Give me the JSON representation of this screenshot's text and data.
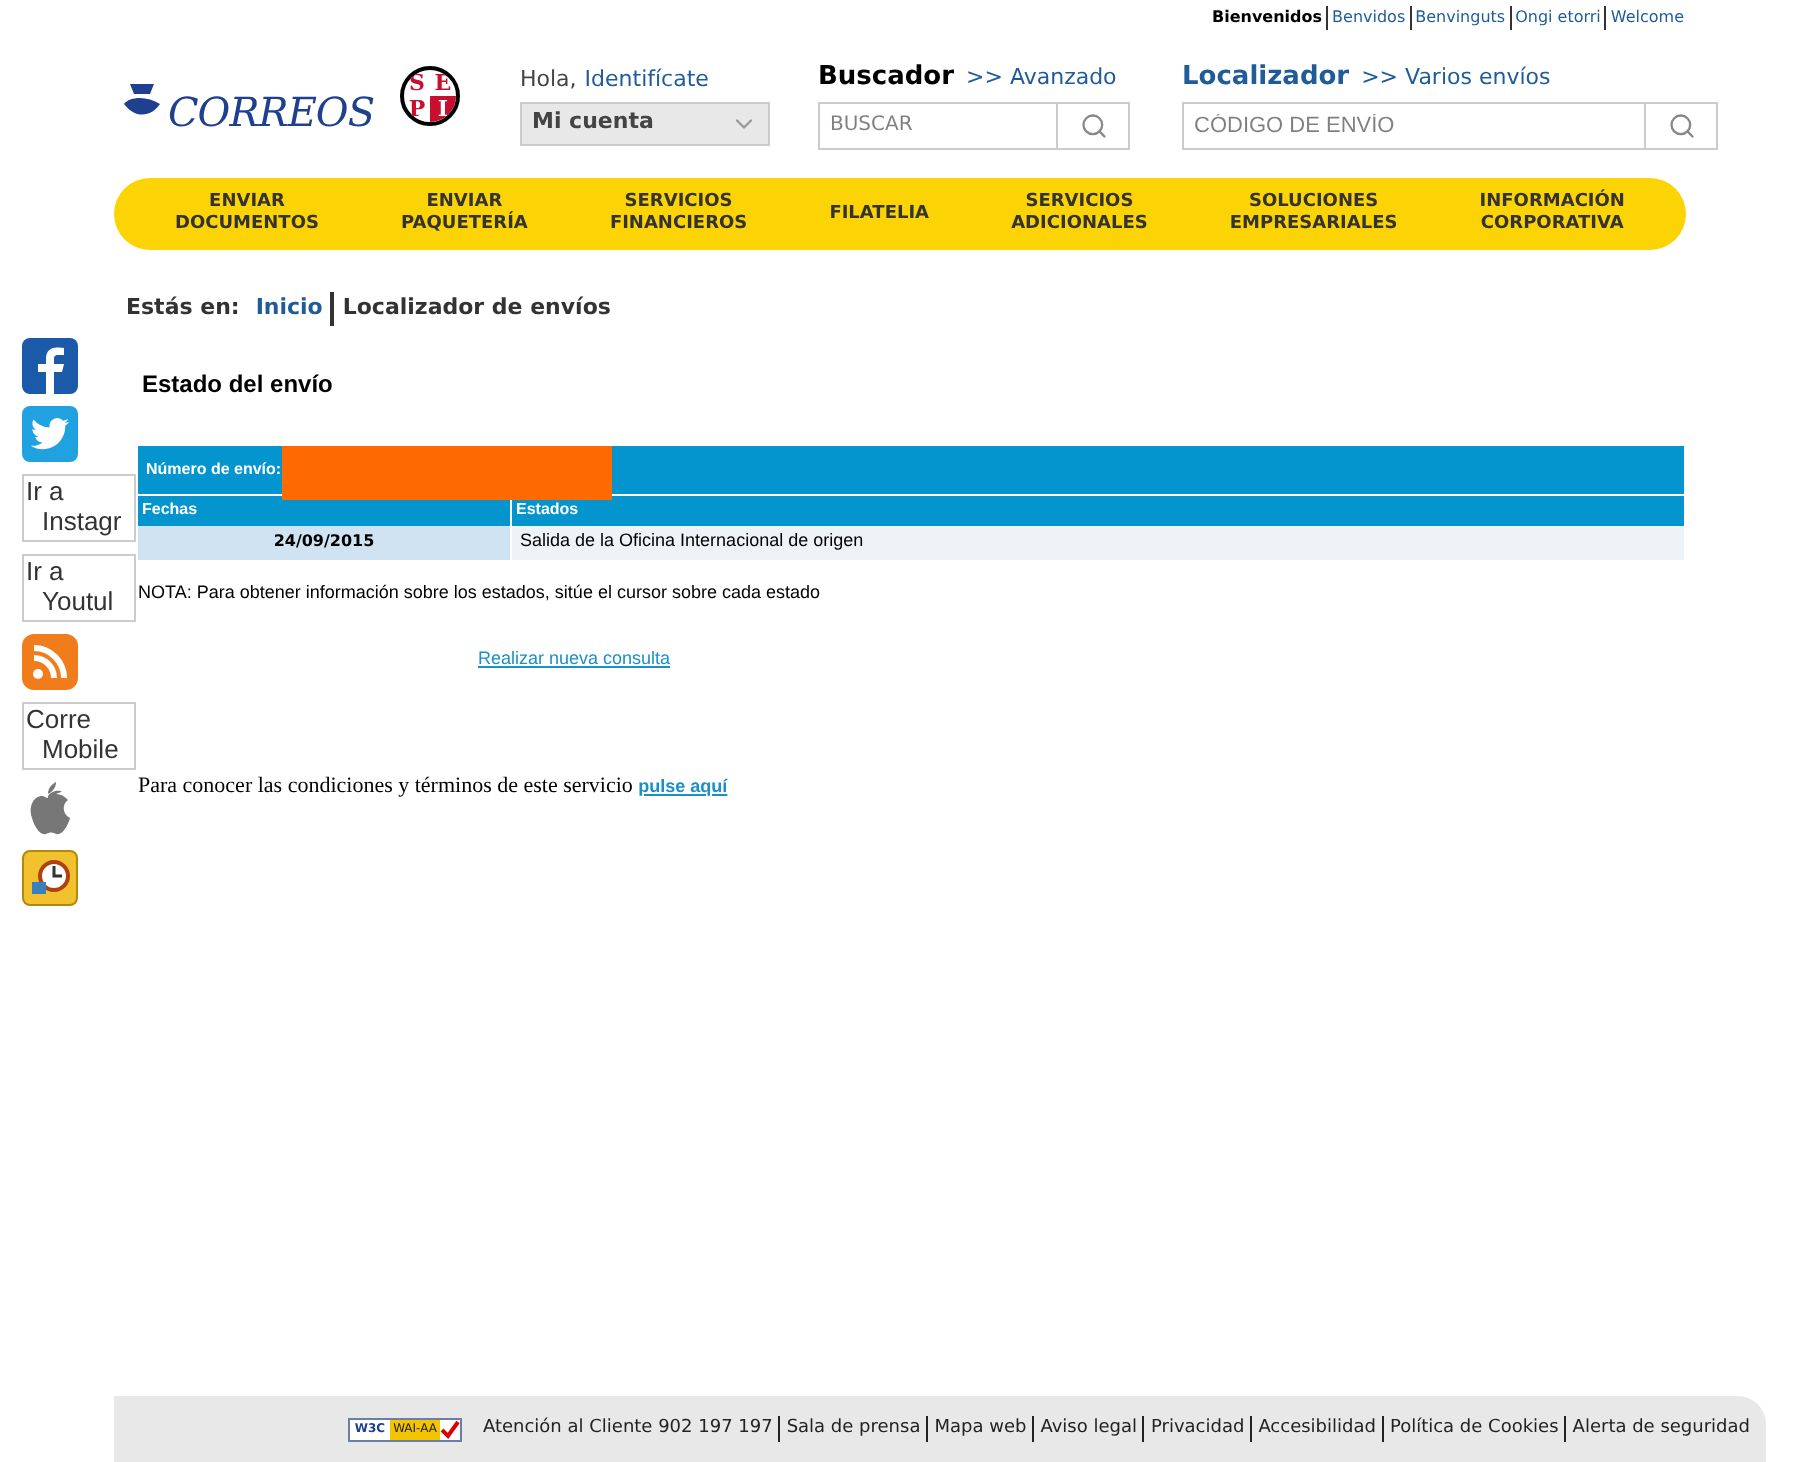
{
  "languages": [
    {
      "label": "Bienvenidos",
      "selected": true
    },
    {
      "label": "Benvidos",
      "selected": false
    },
    {
      "label": "Benvinguts",
      "selected": false
    },
    {
      "label": "Ongi etorri",
      "selected": false
    },
    {
      "label": "Welcome",
      "selected": false
    }
  ],
  "logo": {
    "brand": "CORREOS",
    "badge": [
      "S",
      "E",
      "P",
      "I"
    ]
  },
  "account": {
    "greeting": "Hola,",
    "login_link": "Identifícate",
    "dropdown": "Mi cuenta"
  },
  "search": {
    "title": "Buscador",
    "link": ">> Avanzado",
    "placeholder": "BUSCAR"
  },
  "locator": {
    "title": "Localizador",
    "link": ">> Varios envíos",
    "placeholder": "CÓDIGO DE ENVÍO"
  },
  "nav": [
    [
      "ENVIAR",
      "DOCUMENTOS"
    ],
    [
      "ENVIAR",
      "PAQUETERÍA"
    ],
    [
      "SERVICIOS",
      "FINANCIEROS"
    ],
    [
      "FILATELIA"
    ],
    [
      "SERVICIOS",
      "ADICIONALES"
    ],
    [
      "SOLUCIONES",
      "EMPRESARIALES"
    ],
    [
      "INFORMACIÓN",
      "CORPORATIVA"
    ]
  ],
  "breadcrumb": {
    "label": "Estás en:",
    "items": [
      "Inicio",
      "Localizador de envíos"
    ]
  },
  "social": [
    {
      "kind": "facebook"
    },
    {
      "kind": "twitter"
    },
    {
      "kind": "broken",
      "alt": [
        "Ir a",
        "Instagr"
      ]
    },
    {
      "kind": "broken",
      "alt": [
        "Ir a",
        "Youtul"
      ]
    },
    {
      "kind": "rss"
    },
    {
      "kind": "broken",
      "alt": [
        "Corre",
        "Mobile"
      ]
    },
    {
      "kind": "apple"
    },
    {
      "kind": "clock"
    }
  ],
  "page_title": "Estado del envío",
  "table": {
    "number_label": "Número de envío:",
    "columns": [
      "Fechas",
      "Estados"
    ],
    "rows": [
      [
        "24/09/2015",
        "Salida de la Oficina Internacional de origen"
      ]
    ]
  },
  "note": "NOTA: Para obtener información sobre los estados, sitúe el cursor sobre cada estado",
  "new_query_link": "Realizar nueva consulta",
  "terms": {
    "text": "Para conocer las condiciones y términos de este servicio",
    "link": "pulse aquí"
  },
  "footer": {
    "badge": [
      "W3C",
      "WAI-AA"
    ],
    "links": [
      "Atención al Cliente 902 197 197",
      "Sala de prensa",
      "Mapa web",
      "Aviso legal",
      "Privacidad",
      "Accesibilidad",
      "Política de Cookies",
      "Alerta de seguridad"
    ]
  }
}
